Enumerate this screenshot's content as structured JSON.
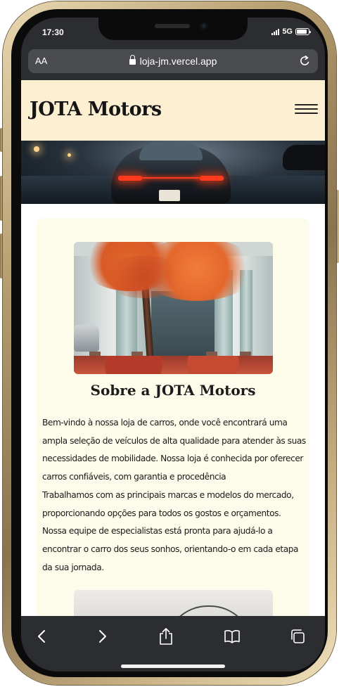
{
  "status_bar": {
    "time": "17:30",
    "network": "5G",
    "battery_level": 0.85
  },
  "browser": {
    "text_size_label": "AA",
    "url": "loja-jm.vercel.app",
    "icons": {
      "lock": "lock-icon",
      "reload": "reload-icon"
    }
  },
  "site": {
    "brand": "JOTA Motors",
    "menu_icon": "hamburger-menu-icon",
    "about": {
      "title": "Sobre a JOTA Motors",
      "lines": [
        "Bem-vindo à nossa loja de carros, onde você encontrará uma",
        "ampla seleção de veículos de alta qualidade para atender às suas",
        "necessidades de mobilidade. Nossa loja é conhecida por oferecer",
        "carros confiáveis, com garantia e procedência",
        "Trabalhamos com as principais marcas e modelos do mercado,",
        "proporcionando opções para todos os gostos e orçamentos.",
        "Nossa equipe de especialistas está pronta para ajudá-lo a",
        "encontrar o carro dos seus sonhos, orientando-o em cada etapa",
        "da sua jornada."
      ]
    }
  },
  "toolbar": {
    "icons": [
      "back-icon",
      "forward-icon",
      "share-icon",
      "bookmarks-icon",
      "tabs-icon"
    ]
  },
  "colors": {
    "header_bg": "#fdf0d2",
    "content_bg": "#fdfbe9",
    "browser_chrome": "#2c2d30",
    "frame_gold": "#b39a6c"
  }
}
